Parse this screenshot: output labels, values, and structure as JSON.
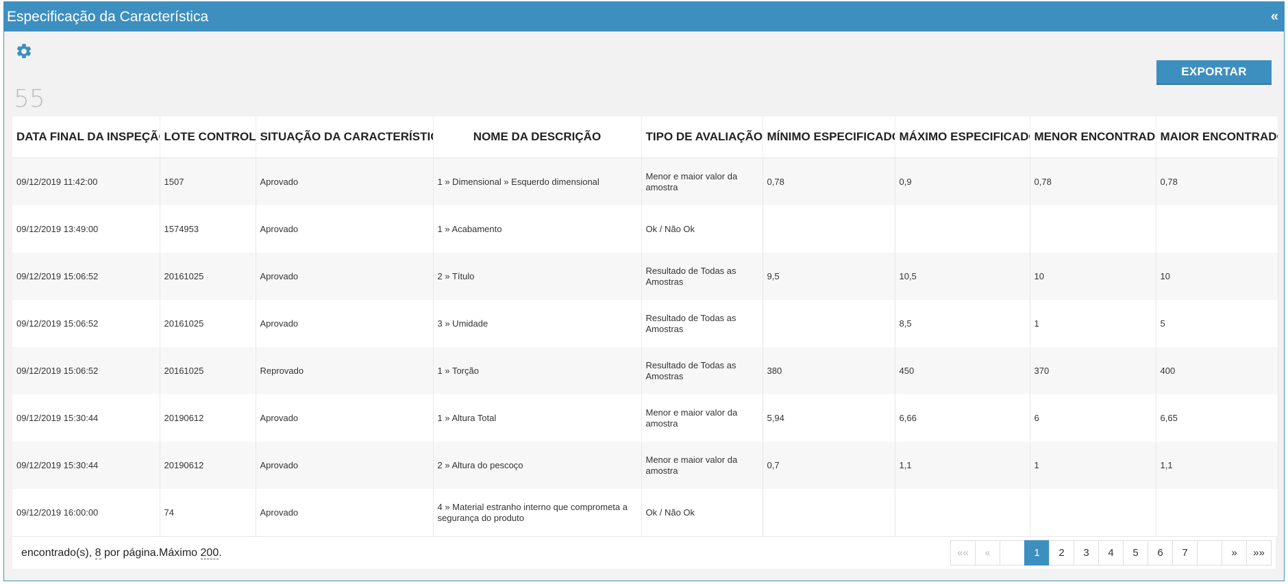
{
  "header": {
    "title": "Especificação da Característica",
    "collapse_symbol": "«"
  },
  "toolbar": {
    "export_label": "EXPORTAR",
    "record_count": "55"
  },
  "colors": {
    "accent": "#3d8fc0"
  },
  "table": {
    "columns": [
      "DATA FINAL DA INSPEÇÃO",
      "LOTE CONTROLE",
      "SITUAÇÃO DA CARACTERÍSTICA",
      "NOME DA DESCRIÇÃO",
      "TIPO DE AVALIAÇÃO",
      "MÍNIMO ESPECIFICADO",
      "MÁXIMO ESPECIFICADO",
      "MENOR ENCONTRADO",
      "MAIOR ENCONTRADO"
    ],
    "rows": [
      [
        "09/12/2019 11:42:00",
        "1507",
        "Aprovado",
        "1 » Dimensional » Esquerdo dimensional",
        "Menor e maior valor da amostra",
        "0,78",
        "0,9",
        "0,78",
        "0,78"
      ],
      [
        "09/12/2019 13:49:00",
        "1574953",
        "Aprovado",
        "1 » Acabamento",
        "Ok / Não Ok",
        "",
        "",
        "",
        ""
      ],
      [
        "09/12/2019 15:06:52",
        "20161025",
        "Aprovado",
        "2 » Título",
        "Resultado de Todas as Amostras",
        "9,5",
        "10,5",
        "10",
        "10"
      ],
      [
        "09/12/2019 15:06:52",
        "20161025",
        "Aprovado",
        "3 » Umidade",
        "Resultado de Todas as Amostras",
        "",
        "8,5",
        "1",
        "5"
      ],
      [
        "09/12/2019 15:06:52",
        "20161025",
        "Reprovado",
        "1 » Torção",
        "Resultado de Todas as Amostras",
        "380",
        "450",
        "370",
        "400"
      ],
      [
        "09/12/2019 15:30:44",
        "20190612",
        "Aprovado",
        "1 » Altura Total",
        "Menor e maior valor da amostra",
        "5,94",
        "6,66",
        "6",
        "6,65"
      ],
      [
        "09/12/2019 15:30:44",
        "20190612",
        "Aprovado",
        "2 » Altura do pescoço",
        "Menor e maior valor da amostra",
        "0,7",
        "1,1",
        "1",
        "1,1"
      ],
      [
        "09/12/2019 16:00:00",
        "74",
        "Aprovado",
        "4 » Material estranho interno que comprometa a segurança do produto",
        "Ok / Não Ok",
        "",
        "",
        "",
        ""
      ]
    ]
  },
  "footer": {
    "found_label": "encontrado(s),",
    "per_page": "8",
    "per_page_label": "por página.Máximo",
    "max": "200",
    "end": "."
  },
  "pagination": {
    "first": "««",
    "prev": "«",
    "pages": [
      "1",
      "2",
      "3",
      "4",
      "5",
      "6",
      "7"
    ],
    "current": "1",
    "next": "»",
    "last": "»»"
  }
}
